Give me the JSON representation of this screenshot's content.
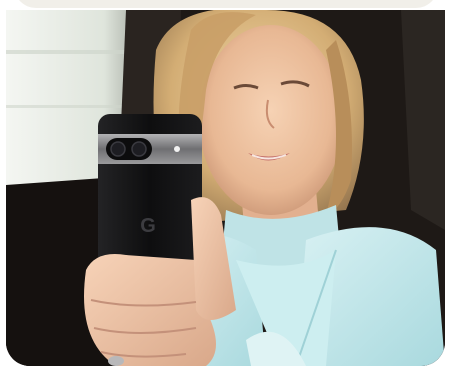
{
  "hero": {
    "description_icon": "phone-logo-icon",
    "phone_logo": "G",
    "colors": {
      "background": "#1a1614",
      "window_light": "#eef2ec",
      "skin": "#f0c8a8",
      "hair": "#d8b27a",
      "jacket": "#bfe6ea",
      "phone_body": "#121213",
      "camera_bar": "#8e8e90"
    }
  }
}
